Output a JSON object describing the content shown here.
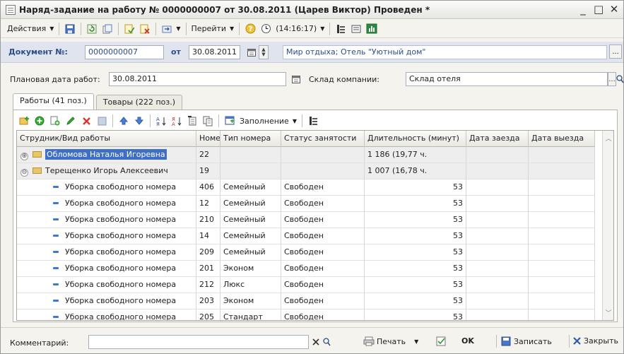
{
  "window": {
    "title": "Наряд-задание на работу № 0000000007 от 30.08.2011 (Царев Виктор) Проведен *",
    "min_glyph": "_",
    "max_glyph": "□",
    "close_glyph": "✕"
  },
  "toolbar": {
    "actions_label": "Действия",
    "goto_label": "Перейти",
    "time_label": "(14:16:17)"
  },
  "header": {
    "doc_label": "Документ №:",
    "doc_number": "0000000007",
    "date_label": "от",
    "date_value": "30.08.2011",
    "organization": "Мир отдыха; Отель \"Уютный дом\""
  },
  "planned": {
    "label": "Плановая дата работ:",
    "value": "30.08.2011",
    "warehouse_label": "Склад компании:",
    "warehouse_value": "Склад отеля"
  },
  "tabs": [
    {
      "label": "Работы (41 поз.)",
      "active": true
    },
    {
      "label": "Товары (222 поз.)",
      "active": false
    }
  ],
  "grid_toolbar": {
    "fill_label": "Заполнение"
  },
  "grid": {
    "columns": [
      "Струдник/Вид работы",
      "Номер",
      "Тип номера",
      "Статус занятости",
      "Длительность (минут)",
      "Дата заезда",
      "Дата выезда"
    ],
    "groups": [
      {
        "name": "Обломова Наталья Игоревна",
        "number": "22",
        "duration": "1 186 (19,77 ч.",
        "expander": "⊕",
        "selected": true
      },
      {
        "name": "Терещенко Игорь Алексеевич",
        "number": "19",
        "duration": "1 007 (16,78 ч.",
        "expander": "⊖",
        "selected": false
      }
    ],
    "rows": [
      {
        "work": "Уборка свободного номера",
        "room": "406",
        "type": "Семейный",
        "status": "Свободен",
        "duration": "53"
      },
      {
        "work": "Уборка свободного номера",
        "room": "12",
        "type": "Семейный",
        "status": "Свободен",
        "duration": "53"
      },
      {
        "work": "Уборка свободного номера",
        "room": "210",
        "type": "Семейный",
        "status": "Свободен",
        "duration": "53"
      },
      {
        "work": "Уборка свободного номера",
        "room": "14",
        "type": "Семейный",
        "status": "Свободен",
        "duration": "53"
      },
      {
        "work": "Уборка свободного номера",
        "room": "209",
        "type": "Семейный",
        "status": "Свободен",
        "duration": "53"
      },
      {
        "work": "Уборка свободного номера",
        "room": "201",
        "type": "Эконом",
        "status": "Свободен",
        "duration": "53"
      },
      {
        "work": "Уборка свободного номера",
        "room": "212",
        "type": "Люкс",
        "status": "Свободен",
        "duration": "53"
      },
      {
        "work": "Уборка свободного номера",
        "room": "203",
        "type": "Эконом",
        "status": "Свободен",
        "duration": "53"
      },
      {
        "work": "Уборка свободного номера",
        "room": "205",
        "type": "Стандарт",
        "status": "Свободен",
        "duration": "53"
      }
    ]
  },
  "footer": {
    "comment_label": "Комментарий:",
    "comment_value": "",
    "print_label": "Печать",
    "ok_label": "OK",
    "save_label": "Записать",
    "close_label": "Закрыть"
  },
  "colors": {
    "header_band": "#dfe4ef",
    "label_blue": "#2c4d8a",
    "selection": "#3f6fc4",
    "group_row": "#eeeeee"
  }
}
